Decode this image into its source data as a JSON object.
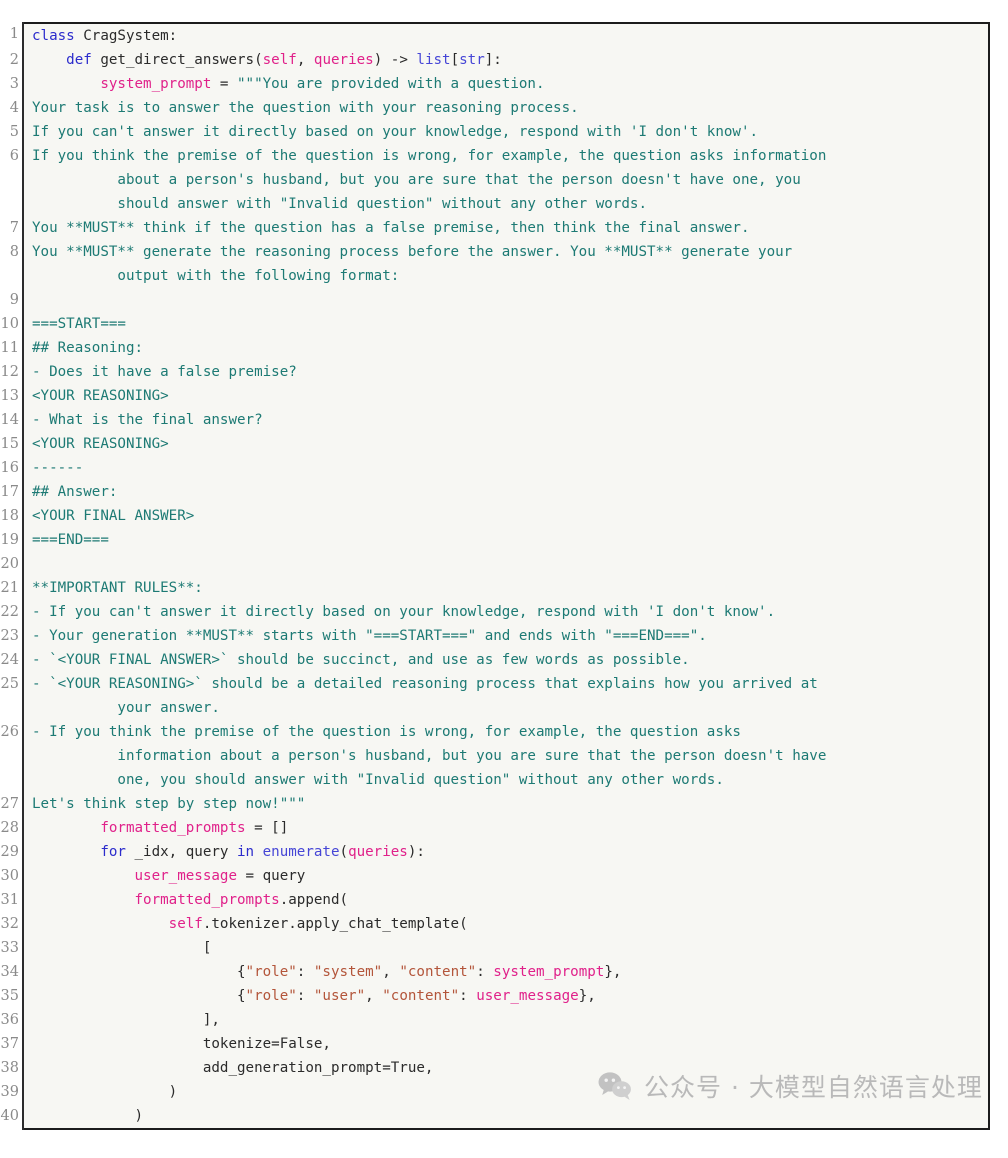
{
  "document": {
    "language": "python",
    "first_line_number": 1,
    "last_line_number": 40,
    "colors": {
      "background": "#f7f7f3",
      "page": "#ffffff",
      "border": "#1c1c1c",
      "line_number": "#8a8a8a",
      "keyword": "#2c2ccc",
      "builtin": "#4646d6",
      "variable": "#e0218a",
      "docstring": "#1d7a74",
      "string": "#b3553a",
      "plain": "#2b2b2b",
      "watermark": "#b9b9b9"
    }
  },
  "watermark": {
    "icon": "wechat-logo",
    "text": "公众号 · 大模型自然语言处理"
  },
  "lines": [
    {
      "n": "1",
      "tokens": [
        {
          "t": "class ",
          "c": "kw"
        },
        {
          "t": "CragSystem:",
          "c": "pln"
        }
      ]
    },
    {
      "n": "2",
      "tokens": [
        {
          "t": "    ",
          "c": "pln"
        },
        {
          "t": "def ",
          "c": "kw"
        },
        {
          "t": "get_direct_answers(",
          "c": "pln"
        },
        {
          "t": "self",
          "c": "var"
        },
        {
          "t": ", ",
          "c": "pln"
        },
        {
          "t": "queries",
          "c": "var"
        },
        {
          "t": ") -> ",
          "c": "pln"
        },
        {
          "t": "list",
          "c": "bfn"
        },
        {
          "t": "[",
          "c": "pln"
        },
        {
          "t": "str",
          "c": "bfn"
        },
        {
          "t": "]:",
          "c": "pln"
        }
      ]
    },
    {
      "n": "3",
      "tokens": [
        {
          "t": "        ",
          "c": "pln"
        },
        {
          "t": "system_prompt",
          "c": "var"
        },
        {
          "t": " = ",
          "c": "pln"
        },
        {
          "t": "\"\"\"You are provided with a question.",
          "c": "doc"
        }
      ]
    },
    {
      "n": "4",
      "tokens": [
        {
          "t": "Your task is to answer the question with your reasoning process.",
          "c": "doc"
        }
      ]
    },
    {
      "n": "5",
      "tokens": [
        {
          "t": "If you can't answer it directly based on your knowledge, respond with 'I don't know'.",
          "c": "doc"
        }
      ]
    },
    {
      "n": "6",
      "tokens": [
        {
          "t": "If you think the premise of the question is wrong, for example, the question asks information",
          "c": "doc"
        }
      ],
      "wrapped": [
        "          about a person's husband, but you are sure that the person doesn't have one, you",
        "          should answer with \"Invalid question\" without any other words."
      ]
    },
    {
      "n": "7",
      "tokens": [
        {
          "t": "You **MUST** think if the question has a false premise, then think the final answer.",
          "c": "doc"
        }
      ]
    },
    {
      "n": "8",
      "tokens": [
        {
          "t": "You **MUST** generate the reasoning process before the answer. You **MUST** generate your",
          "c": "doc"
        }
      ],
      "wrapped": [
        "          output with the following format:"
      ]
    },
    {
      "n": "9",
      "tokens": [
        {
          "t": "",
          "c": "doc"
        }
      ]
    },
    {
      "n": "10",
      "tokens": [
        {
          "t": "===START===",
          "c": "doc"
        }
      ]
    },
    {
      "n": "11",
      "tokens": [
        {
          "t": "## Reasoning:",
          "c": "doc"
        }
      ]
    },
    {
      "n": "12",
      "tokens": [
        {
          "t": "- Does it have a false premise?",
          "c": "doc"
        }
      ]
    },
    {
      "n": "13",
      "tokens": [
        {
          "t": "<YOUR REASONING>",
          "c": "doc"
        }
      ]
    },
    {
      "n": "14",
      "tokens": [
        {
          "t": "- What is the final answer?",
          "c": "doc"
        }
      ]
    },
    {
      "n": "15",
      "tokens": [
        {
          "t": "<YOUR REASONING>",
          "c": "doc"
        }
      ]
    },
    {
      "n": "16",
      "tokens": [
        {
          "t": "------",
          "c": "doc"
        }
      ]
    },
    {
      "n": "17",
      "tokens": [
        {
          "t": "## Answer:",
          "c": "doc"
        }
      ]
    },
    {
      "n": "18",
      "tokens": [
        {
          "t": "<YOUR FINAL ANSWER>",
          "c": "doc"
        }
      ]
    },
    {
      "n": "19",
      "tokens": [
        {
          "t": "===END===",
          "c": "doc"
        }
      ]
    },
    {
      "n": "20",
      "tokens": [
        {
          "t": "",
          "c": "doc"
        }
      ]
    },
    {
      "n": "21",
      "tokens": [
        {
          "t": "**IMPORTANT RULES**:",
          "c": "doc"
        }
      ]
    },
    {
      "n": "22",
      "tokens": [
        {
          "t": "- If you can't answer it directly based on your knowledge, respond with 'I don't know'.",
          "c": "doc"
        }
      ]
    },
    {
      "n": "23",
      "tokens": [
        {
          "t": "- Your generation **MUST** starts with \"===START===\" and ends with \"===END===\".",
          "c": "doc"
        }
      ]
    },
    {
      "n": "24",
      "tokens": [
        {
          "t": "- `<YOUR FINAL ANSWER>` should be succinct, and use as few words as possible.",
          "c": "doc"
        }
      ]
    },
    {
      "n": "25",
      "tokens": [
        {
          "t": "- `<YOUR REASONING>` should be a detailed reasoning process that explains how you arrived at",
          "c": "doc"
        }
      ],
      "wrapped": [
        "          your answer."
      ]
    },
    {
      "n": "26",
      "tokens": [
        {
          "t": "- If you think the premise of the question is wrong, for example, the question asks",
          "c": "doc"
        }
      ],
      "wrapped": [
        "          information about a person's husband, but you are sure that the person doesn't have",
        "          one, you should answer with \"Invalid question\" without any other words."
      ]
    },
    {
      "n": "27",
      "tokens": [
        {
          "t": "Let's think step by step now!\"\"\"",
          "c": "doc"
        }
      ]
    },
    {
      "n": "28",
      "tokens": [
        {
          "t": "        ",
          "c": "pln"
        },
        {
          "t": "formatted_prompts",
          "c": "var"
        },
        {
          "t": " = []",
          "c": "pln"
        }
      ]
    },
    {
      "n": "29",
      "tokens": [
        {
          "t": "        ",
          "c": "pln"
        },
        {
          "t": "for ",
          "c": "kw"
        },
        {
          "t": "_idx, query ",
          "c": "pln"
        },
        {
          "t": "in ",
          "c": "kw"
        },
        {
          "t": "enumerate",
          "c": "bfn"
        },
        {
          "t": "(",
          "c": "pln"
        },
        {
          "t": "queries",
          "c": "var"
        },
        {
          "t": "):",
          "c": "pln"
        }
      ]
    },
    {
      "n": "30",
      "tokens": [
        {
          "t": "            ",
          "c": "pln"
        },
        {
          "t": "user_message",
          "c": "var"
        },
        {
          "t": " = query",
          "c": "pln"
        }
      ]
    },
    {
      "n": "31",
      "tokens": [
        {
          "t": "            ",
          "c": "pln"
        },
        {
          "t": "formatted_prompts",
          "c": "var"
        },
        {
          "t": ".append(",
          "c": "pln"
        }
      ]
    },
    {
      "n": "32",
      "tokens": [
        {
          "t": "                ",
          "c": "pln"
        },
        {
          "t": "self",
          "c": "var"
        },
        {
          "t": ".tokenizer.apply_chat_template(",
          "c": "pln"
        }
      ]
    },
    {
      "n": "33",
      "tokens": [
        {
          "t": "                    [",
          "c": "pln"
        }
      ]
    },
    {
      "n": "34",
      "tokens": [
        {
          "t": "                        {",
          "c": "pln"
        },
        {
          "t": "\"role\"",
          "c": "str"
        },
        {
          "t": ": ",
          "c": "pln"
        },
        {
          "t": "\"system\"",
          "c": "str"
        },
        {
          "t": ", ",
          "c": "pln"
        },
        {
          "t": "\"content\"",
          "c": "str"
        },
        {
          "t": ": ",
          "c": "pln"
        },
        {
          "t": "system_prompt",
          "c": "var"
        },
        {
          "t": "},",
          "c": "pln"
        }
      ]
    },
    {
      "n": "35",
      "tokens": [
        {
          "t": "                        {",
          "c": "pln"
        },
        {
          "t": "\"role\"",
          "c": "str"
        },
        {
          "t": ": ",
          "c": "pln"
        },
        {
          "t": "\"user\"",
          "c": "str"
        },
        {
          "t": ", ",
          "c": "pln"
        },
        {
          "t": "\"content\"",
          "c": "str"
        },
        {
          "t": ": ",
          "c": "pln"
        },
        {
          "t": "user_message",
          "c": "var"
        },
        {
          "t": "},",
          "c": "pln"
        }
      ]
    },
    {
      "n": "36",
      "tokens": [
        {
          "t": "                    ],",
          "c": "pln"
        }
      ]
    },
    {
      "n": "37",
      "tokens": [
        {
          "t": "                    tokenize=False,",
          "c": "pln"
        }
      ]
    },
    {
      "n": "38",
      "tokens": [
        {
          "t": "                    add_generation_prompt=True,",
          "c": "pln"
        }
      ]
    },
    {
      "n": "39",
      "tokens": [
        {
          "t": "                )",
          "c": "pln"
        }
      ]
    },
    {
      "n": "40",
      "tokens": [
        {
          "t": "            )",
          "c": "pln"
        }
      ]
    }
  ]
}
